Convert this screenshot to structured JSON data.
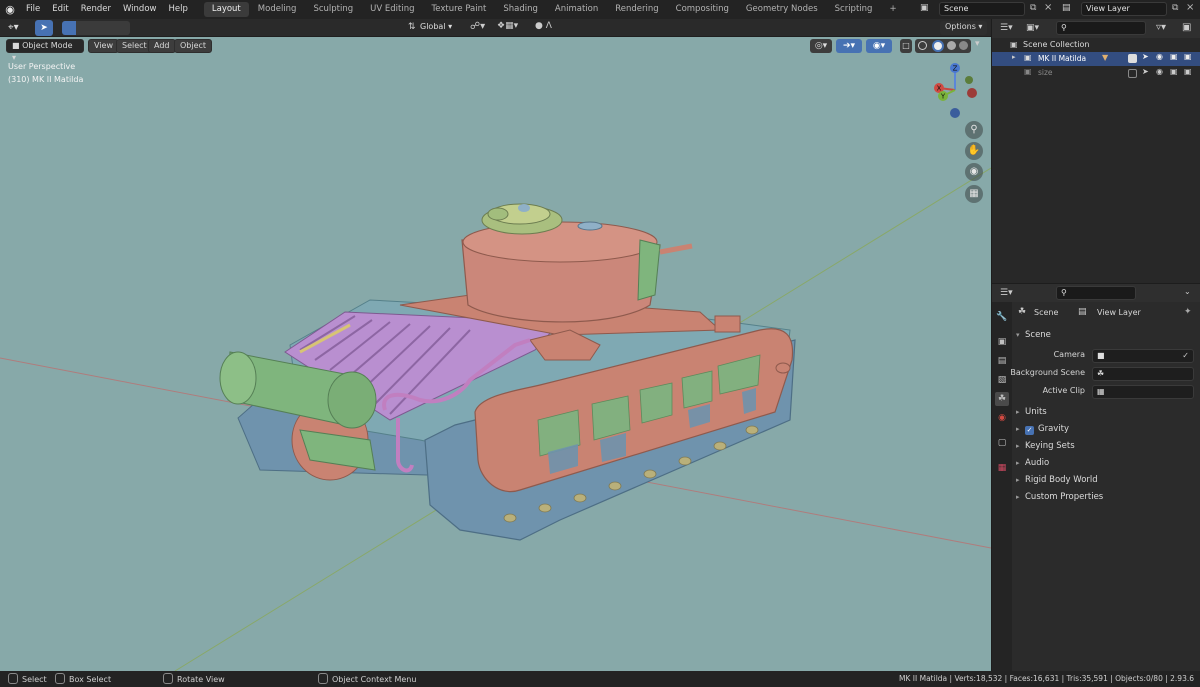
{
  "topbar": {
    "menus": [
      "File",
      "Edit",
      "Render",
      "Window",
      "Help"
    ],
    "workspaces": [
      "Layout",
      "Modeling",
      "Sculpting",
      "UV Editing",
      "Texture Paint",
      "Shading",
      "Animation",
      "Rendering",
      "Compositing",
      "Geometry Nodes",
      "Scripting"
    ],
    "active_workspace": "Layout",
    "add_tab": "+",
    "scene_name": "Scene",
    "view_layer_name": "View Layer"
  },
  "viewport_header": {
    "mode": "Object Mode",
    "menus": [
      "View",
      "Select",
      "Add",
      "Object"
    ],
    "transform_orientation": "Global",
    "options_label": "Options"
  },
  "viewport": {
    "perspective_label": "User Perspective",
    "object_label": "(310) MK II Matilda",
    "gizmo_axes": {
      "x": "X",
      "y": "Y",
      "z": "Z"
    }
  },
  "outliner": {
    "root": "Scene Collection",
    "items": [
      {
        "name": "MK II Matilda",
        "selected": true
      },
      {
        "name": "size",
        "selected": false
      }
    ]
  },
  "properties": {
    "header_scene": "Scene",
    "header_view_layer": "View Layer",
    "section_title": "Scene",
    "fields": [
      {
        "label": "Camera",
        "value": ""
      },
      {
        "label": "Background Scene",
        "value": ""
      },
      {
        "label": "Active Clip",
        "value": ""
      }
    ],
    "panels": [
      "Units",
      "Gravity",
      "Keying Sets",
      "Audio",
      "Rigid Body World",
      "Custom Properties"
    ],
    "gravity_checked": true
  },
  "statusbar": {
    "select": "Select",
    "box_select": "Box Select",
    "rotate_view": "Rotate View",
    "context_menu": "Object Context Menu",
    "stats": "MK II Matilda | Verts:18,532 | Faces:16,631 | Tris:35,591 | Objects:0/80 | 2.93.6"
  },
  "colors": {
    "viewport_bg": "#87a9a9",
    "accent_blue": "#4772b3",
    "hull_red": "#c98372",
    "turret_red": "#cb877a",
    "track_blue": "#6f93ad",
    "green_parts": "#7fb57d",
    "pipes_purple": "#c17fc0",
    "hull_teal": "#7fa9b3"
  },
  "icons": [
    "blender-logo-icon",
    "search-icon",
    "filter-icon",
    "eye-icon",
    "camera-icon",
    "cursor-icon",
    "zoom-icon",
    "hand-icon",
    "camera-view-icon",
    "grid-icon"
  ]
}
